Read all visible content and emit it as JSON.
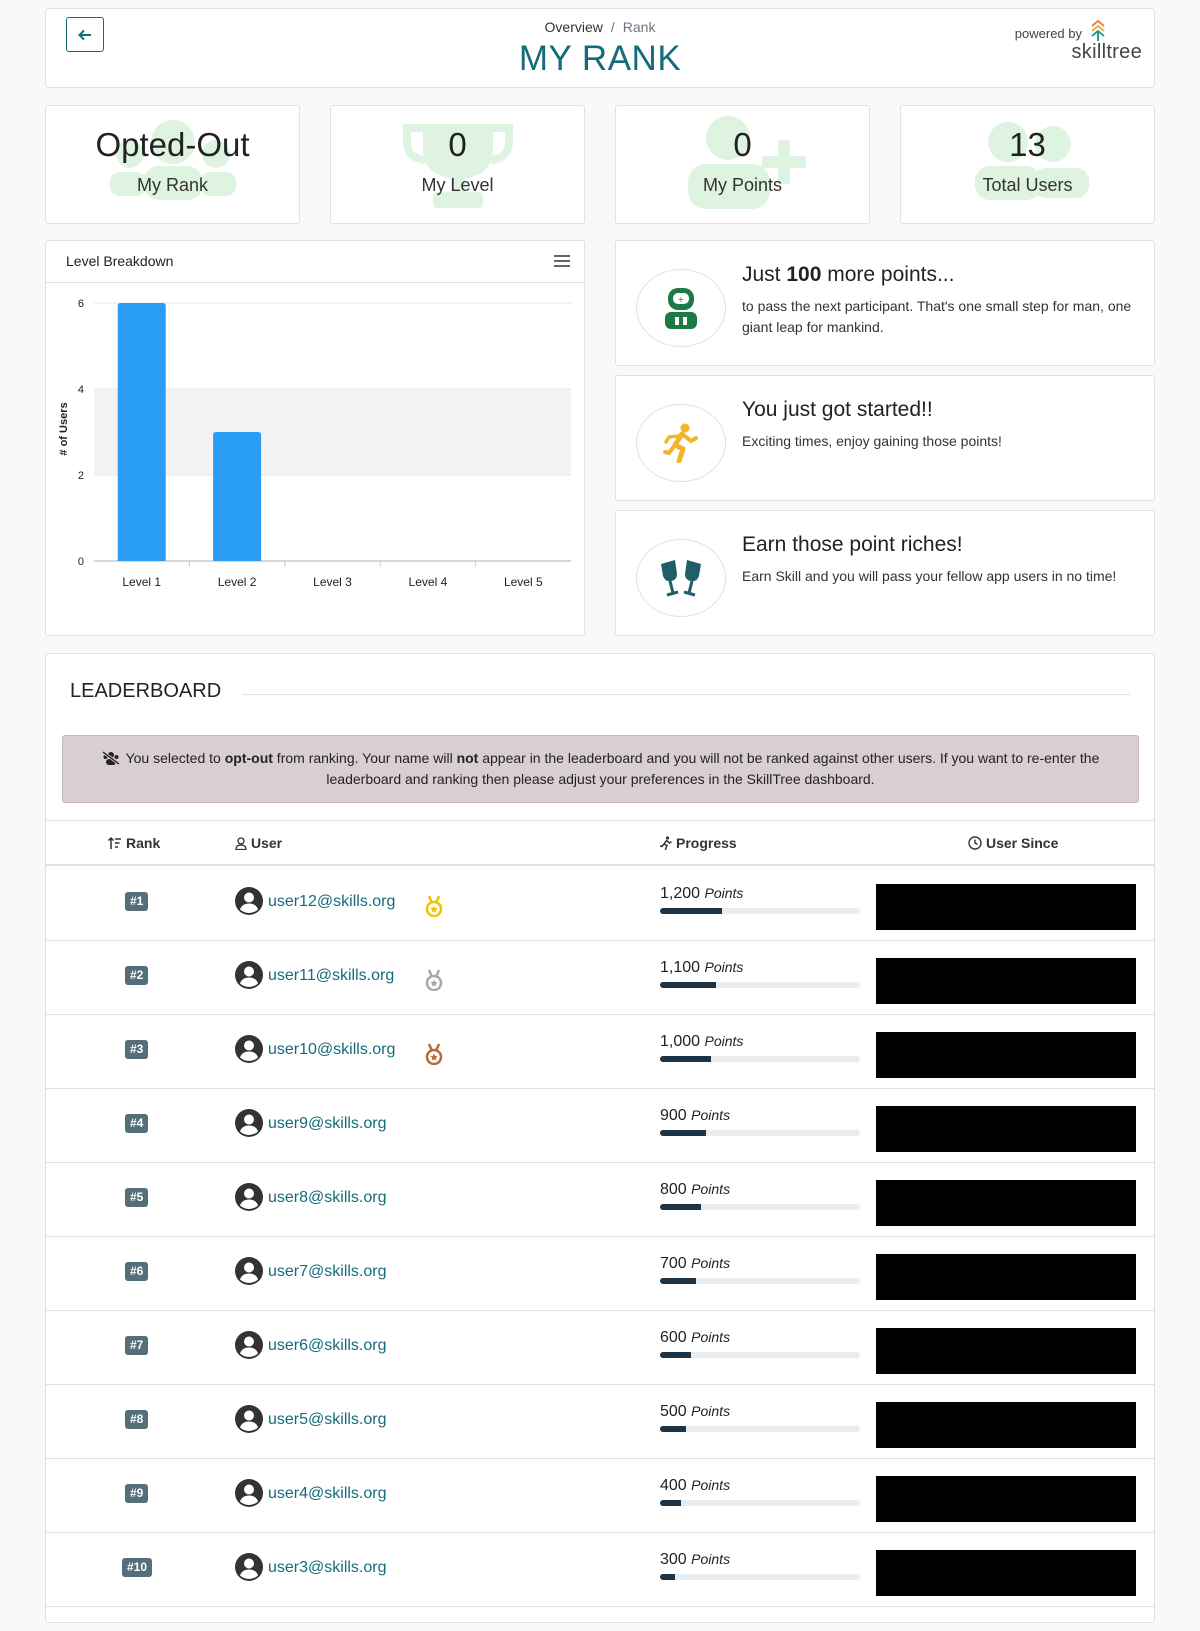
{
  "header": {
    "breadcrumb": [
      {
        "label": "Overview"
      },
      {
        "label": "Rank"
      }
    ],
    "breadcrumb_sep": "/",
    "title": "MY RANK",
    "powered_by": "powered by",
    "brand": "skilltree"
  },
  "stats": [
    {
      "value": "Opted-Out",
      "label": "My Rank",
      "icon": "users-icon"
    },
    {
      "value": "0",
      "label": "My Level",
      "icon": "trophy-icon"
    },
    {
      "value": "0",
      "label": "My Points",
      "icon": "user-plus-icon"
    },
    {
      "value": "13",
      "label": "Total Users",
      "icon": "users-icon"
    }
  ],
  "chart_card": {
    "title": "Level Breakdown"
  },
  "chart_data": {
    "type": "bar",
    "categories": [
      "Level 1",
      "Level 2",
      "Level 3",
      "Level 4",
      "Level 5"
    ],
    "values": [
      6,
      3,
      0,
      0,
      0
    ],
    "ylabel": "# of Users",
    "xlabel": "",
    "ylim": [
      0,
      6
    ],
    "yticks": [
      0,
      2,
      4,
      6
    ],
    "color": "#2a9df4"
  },
  "messages": [
    {
      "title_pre": "Just ",
      "title_bold": "100",
      "title_post": " more points...",
      "text": "to pass the next participant. That's one small step for man, one giant leap for mankind.",
      "icon": "astronaut-icon"
    },
    {
      "title_pre": "You just got started!!",
      "title_bold": "",
      "title_post": "",
      "text": "Exciting times, enjoy gaining those points!",
      "icon": "running-icon"
    },
    {
      "title_pre": "Earn those point riches!",
      "title_bold": "",
      "title_post": "",
      "text": "Earn Skill and you will pass your fellow app users in no time!",
      "icon": "glasses-cheers-icon"
    }
  ],
  "leaderboard": {
    "title": "LEADERBOARD",
    "alert": {
      "t1": "You selected to ",
      "b1": "opt-out",
      "t2": " from ranking. Your name will ",
      "b2": "not",
      "t3": " appear in the leaderboard and you will not be ranked against other users. If you want to re-enter the leaderboard and ranking then please adjust your preferences in the SkillTree dashboard."
    },
    "columns": {
      "rank": "Rank",
      "user": "User",
      "progress": "Progress",
      "since": "User Since"
    },
    "points_unit": "Points",
    "max_points": 3900,
    "rows": [
      {
        "rank": "#1",
        "user": "user12@skills.org",
        "points": "1,200",
        "progress": 1200,
        "medal": "gold"
      },
      {
        "rank": "#2",
        "user": "user11@skills.org",
        "points": "1,100",
        "progress": 1100,
        "medal": "silver"
      },
      {
        "rank": "#3",
        "user": "user10@skills.org",
        "points": "1,000",
        "progress": 1000,
        "medal": "bronze"
      },
      {
        "rank": "#4",
        "user": "user9@skills.org",
        "points": "900",
        "progress": 900,
        "medal": ""
      },
      {
        "rank": "#5",
        "user": "user8@skills.org",
        "points": "800",
        "progress": 800,
        "medal": ""
      },
      {
        "rank": "#6",
        "user": "user7@skills.org",
        "points": "700",
        "progress": 700,
        "medal": ""
      },
      {
        "rank": "#7",
        "user": "user6@skills.org",
        "points": "600",
        "progress": 600,
        "medal": ""
      },
      {
        "rank": "#8",
        "user": "user5@skills.org",
        "points": "500",
        "progress": 500,
        "medal": ""
      },
      {
        "rank": "#9",
        "user": "user4@skills.org",
        "points": "400",
        "progress": 400,
        "medal": ""
      },
      {
        "rank": "#10",
        "user": "user3@skills.org",
        "points": "300",
        "progress": 300,
        "medal": ""
      }
    ]
  },
  "colors": {
    "accent": "#146c7a",
    "stat_icon": "#dff3e1",
    "bar": "#2a9df4",
    "gold": "#f2c200",
    "silver": "#a8a8a8",
    "bronze": "#b86b34"
  }
}
